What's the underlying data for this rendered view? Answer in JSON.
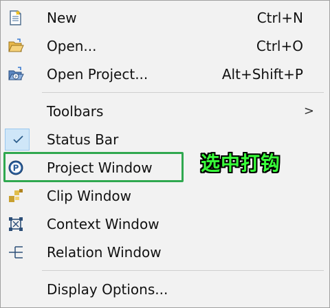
{
  "menu": {
    "items": [
      {
        "label": "New",
        "shortcut": "Ctrl+N",
        "icon": "new-file-icon"
      },
      {
        "label": "Open...",
        "shortcut": "Ctrl+O",
        "icon": "open-folder-icon"
      },
      {
        "label": "Open Project...",
        "shortcut": "Alt+Shift+P",
        "icon": "open-project-icon"
      },
      {
        "label": "Toolbars",
        "submenu_arrow": ">"
      },
      {
        "label": "Status Bar",
        "checked": true,
        "icon": "checkmark-icon"
      },
      {
        "label": "Project Window",
        "icon": "project-p-icon"
      },
      {
        "label": "Clip Window",
        "icon": "clip-window-icon"
      },
      {
        "label": "Context Window",
        "icon": "context-window-icon"
      },
      {
        "label": "Relation Window",
        "icon": "relation-tree-icon"
      },
      {
        "label": "Display Options..."
      }
    ]
  },
  "annotation": {
    "text": "选中打钩",
    "color": "#39ff3a",
    "highlight_color": "#2fa84f"
  }
}
